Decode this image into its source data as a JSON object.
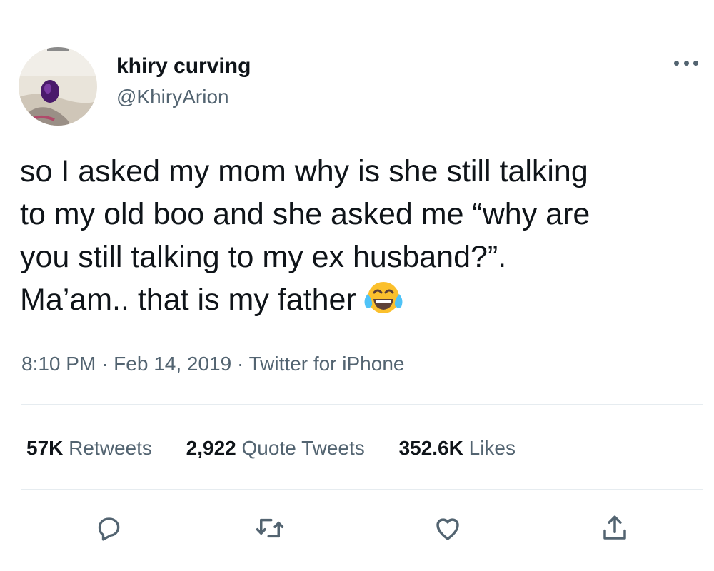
{
  "author": {
    "display_name": "khiry curving",
    "handle": "@KhiryArion",
    "avatar_icon": "profile-photo"
  },
  "more_icon": "more-options-icon",
  "tweet": {
    "lines": [
      "so I asked my mom why is she still talking",
      "to my old boo and she asked me “why are",
      "you still talking to my ex husband?”.",
      "Ma’am.. that is my father"
    ],
    "emoji": "face-with-tears-of-joy"
  },
  "meta": {
    "time": "8:10 PM",
    "separator": " · ",
    "date": "Feb 14, 2019",
    "source": "Twitter for iPhone"
  },
  "stats": {
    "retweets": {
      "count": "57K",
      "label": "Retweets"
    },
    "quotes": {
      "count": "2,922",
      "label": "Quote Tweets"
    },
    "likes": {
      "count": "352.6K",
      "label": "Likes"
    }
  },
  "actions": [
    "reply",
    "retweet",
    "like",
    "share"
  ],
  "colors": {
    "text": "#0f1419",
    "secondary": "#536471",
    "divider": "#e6ecf0",
    "emoji_yellow": "#fbc02d"
  }
}
